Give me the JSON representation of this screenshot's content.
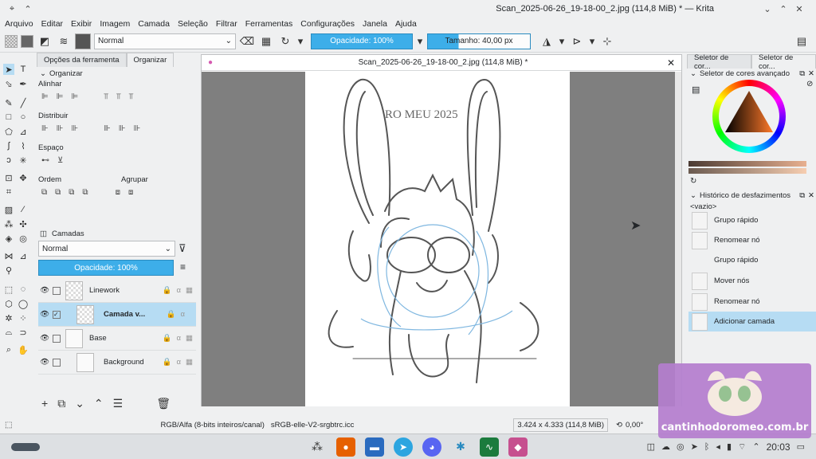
{
  "window": {
    "title": "Scan_2025-06-26_19-18-00_2.jpg (114,8 MiB) * — Krita"
  },
  "menu": [
    "Arquivo",
    "Editar",
    "Exibir",
    "Imagem",
    "Camada",
    "Seleção",
    "Filtrar",
    "Ferramentas",
    "Configurações",
    "Janela",
    "Ajuda"
  ],
  "toolbar": {
    "blend_mode": "Normal",
    "opacity": "Opacidade: 100%",
    "size": "Tamanho: 40,00 px"
  },
  "tool_options": {
    "tab1": "Opções da ferramenta",
    "tab2": "Organizar",
    "section": "Organizar",
    "align": "Alinhar",
    "distribute": "Distribuir",
    "spacing": "Espaço",
    "order": "Ordem",
    "group": "Agrupar"
  },
  "layers": {
    "header": "Camadas",
    "blend": "Normal",
    "opacity": "Opacidade:  100%",
    "items": [
      {
        "name": "Linework"
      },
      {
        "name": "Camada v..."
      },
      {
        "name": "Base"
      },
      {
        "name": "Background"
      }
    ]
  },
  "canvas": {
    "tab_title": "Scan_2025-06-26_19-18-00_2.jpg (114,8 MiB) *",
    "signature": "RO MEU 2025"
  },
  "right_tabs": {
    "tab1": "Seletor de cor...",
    "tab2": "Seletor de cor..."
  },
  "color_selector": {
    "title": "Seletor de cores avançado"
  },
  "history": {
    "title": "Histórico de desfazimentos",
    "empty": "<vazio>",
    "items": [
      "Grupo rápido",
      "Renomear nó",
      "Grupo rápido",
      "Mover nós",
      "Renomear nó",
      "Adicionar camada"
    ]
  },
  "status": {
    "color_model": "RGB/Alfa (8-bits inteiros/canal)",
    "profile": "sRGB-elle-V2-srgbtrc.icc",
    "dimensions": "3.424 x 4.333 (114,8 MiB)",
    "rotation": "0,00°"
  },
  "taskbar": {
    "time": "20:03"
  },
  "watermark": {
    "text": "cantinhodoromeo.com.br"
  }
}
